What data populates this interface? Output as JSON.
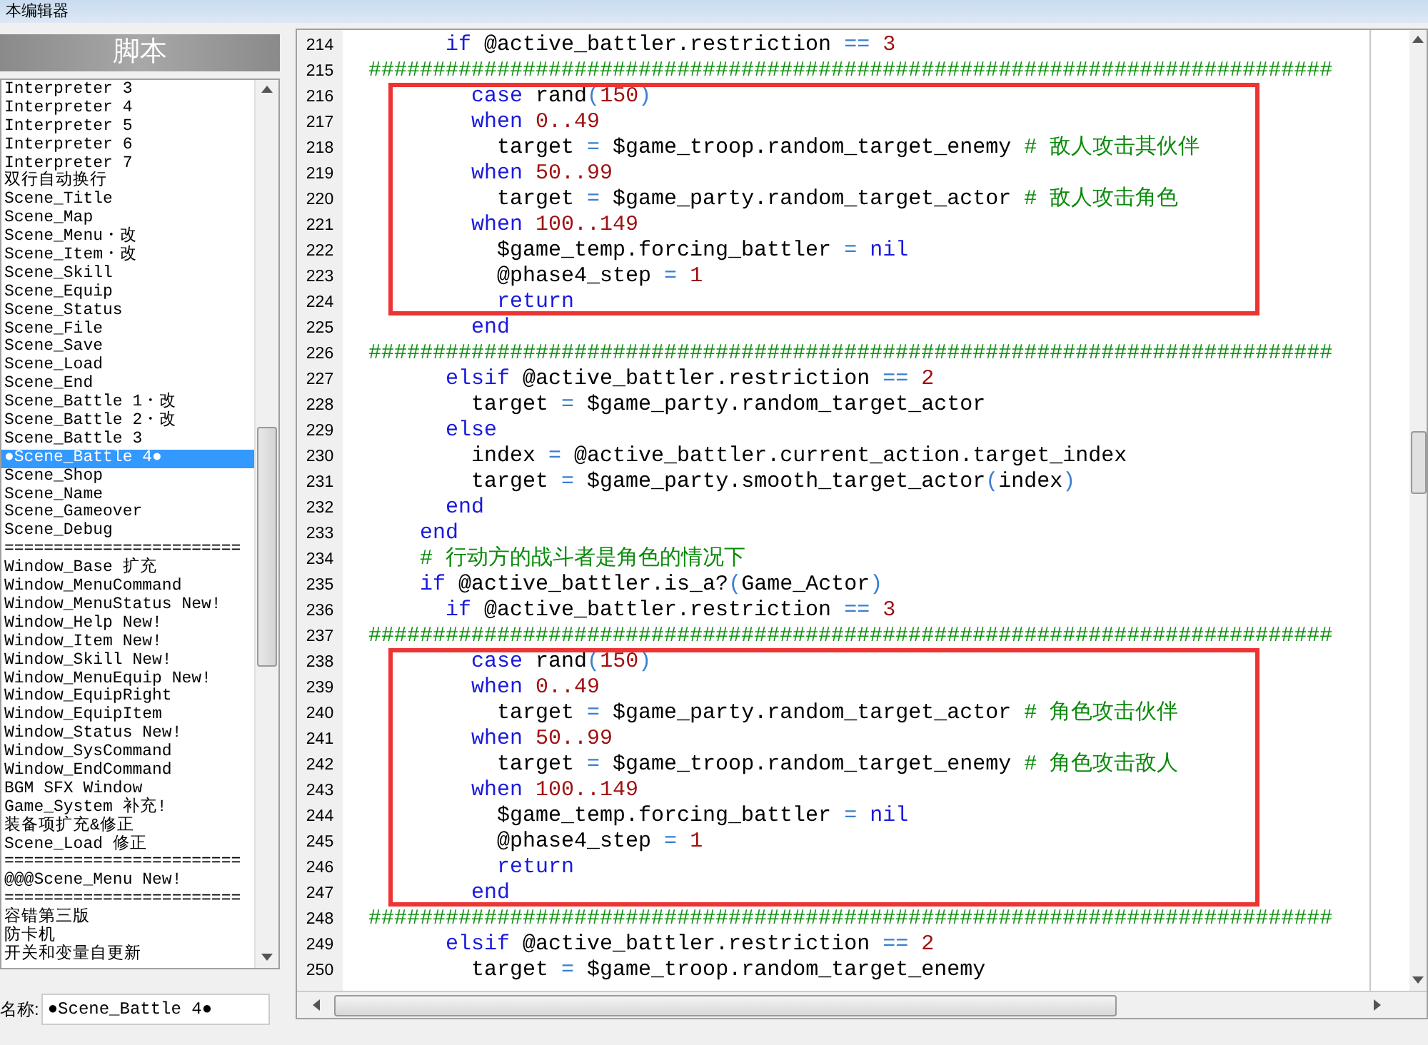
{
  "window": {
    "title": "本编辑器"
  },
  "sidebar": {
    "header": "脚本",
    "items": [
      {
        "label": "Interpreter 3",
        "selected": false
      },
      {
        "label": "Interpreter 4",
        "selected": false
      },
      {
        "label": "Interpreter 5",
        "selected": false
      },
      {
        "label": "Interpreter 6",
        "selected": false
      },
      {
        "label": "Interpreter 7",
        "selected": false
      },
      {
        "label": "双行自动换行",
        "selected": false
      },
      {
        "label": "Scene_Title",
        "selected": false
      },
      {
        "label": "Scene_Map",
        "selected": false
      },
      {
        "label": "Scene_Menu・改",
        "selected": false
      },
      {
        "label": "Scene_Item・改",
        "selected": false
      },
      {
        "label": "Scene_Skill",
        "selected": false
      },
      {
        "label": "Scene_Equip",
        "selected": false
      },
      {
        "label": "Scene_Status",
        "selected": false
      },
      {
        "label": "Scene_File",
        "selected": false
      },
      {
        "label": "Scene_Save",
        "selected": false
      },
      {
        "label": "Scene_Load",
        "selected": false
      },
      {
        "label": "Scene_End",
        "selected": false
      },
      {
        "label": "Scene_Battle 1・改",
        "selected": false
      },
      {
        "label": "Scene_Battle 2・改",
        "selected": false
      },
      {
        "label": "Scene_Battle 3",
        "selected": false
      },
      {
        "label": "●Scene_Battle 4●",
        "selected": true
      },
      {
        "label": "Scene_Shop",
        "selected": false
      },
      {
        "label": "Scene_Name",
        "selected": false
      },
      {
        "label": "Scene_Gameover",
        "selected": false
      },
      {
        "label": "Scene_Debug",
        "selected": false
      },
      {
        "label": "========================",
        "selected": false
      },
      {
        "label": "Window_Base 扩充",
        "selected": false
      },
      {
        "label": "Window_MenuCommand",
        "selected": false
      },
      {
        "label": "Window_MenuStatus New!",
        "selected": false
      },
      {
        "label": "Window_Help New!",
        "selected": false
      },
      {
        "label": "Window_Item New!",
        "selected": false
      },
      {
        "label": "Window_Skill New!",
        "selected": false
      },
      {
        "label": "Window_MenuEquip New!",
        "selected": false
      },
      {
        "label": "Window_EquipRight",
        "selected": false
      },
      {
        "label": "Window_EquipItem",
        "selected": false
      },
      {
        "label": "Window_Status New!",
        "selected": false
      },
      {
        "label": "Window_SysCommand",
        "selected": false
      },
      {
        "label": "Window_EndCommand",
        "selected": false
      },
      {
        "label": "BGM SFX Window",
        "selected": false
      },
      {
        "label": "Game_System 补充!",
        "selected": false
      },
      {
        "label": "装备项扩充&修正",
        "selected": false
      },
      {
        "label": "Scene_Load 修正",
        "selected": false
      },
      {
        "label": "========================",
        "selected": false
      },
      {
        "label": "@@@Scene_Menu New!",
        "selected": false
      },
      {
        "label": "========================",
        "selected": false
      },
      {
        "label": "容错第三版",
        "selected": false
      },
      {
        "label": "防卡机",
        "selected": false
      },
      {
        "label": "开关和变量自更新",
        "selected": false
      }
    ]
  },
  "name_field": {
    "label": "名称:",
    "value": "●Scene_Battle 4●"
  },
  "editor": {
    "lines": [
      {
        "number": "214",
        "boxed": false,
        "tokens": [
          {
            "kind": "kw",
            "text": "      if"
          },
          {
            "kind": "txt",
            "text": " @active_battler.restriction "
          },
          {
            "kind": "op",
            "text": "=="
          },
          {
            "kind": "num",
            "text": " 3"
          }
        ]
      },
      {
        "number": "215",
        "boxed": false,
        "tokens": [
          {
            "kind": "sep",
            "text": "###########################################################################"
          }
        ]
      },
      {
        "number": "216",
        "boxed": true,
        "tokens": [
          {
            "kind": "kw",
            "text": "        case"
          },
          {
            "kind": "txt",
            "text": " rand"
          },
          {
            "kind": "op",
            "text": "("
          },
          {
            "kind": "num",
            "text": "150"
          },
          {
            "kind": "op",
            "text": ")"
          }
        ]
      },
      {
        "number": "217",
        "boxed": true,
        "tokens": [
          {
            "kind": "kw",
            "text": "        when"
          },
          {
            "kind": "num",
            "text": " 0..49"
          }
        ]
      },
      {
        "number": "218",
        "boxed": true,
        "tokens": [
          {
            "kind": "txt",
            "text": "          target "
          },
          {
            "kind": "op",
            "text": "="
          },
          {
            "kind": "txt",
            "text": " $game_troop.random_target_enemy "
          },
          {
            "kind": "cmt",
            "text": "# 敌人攻击其伙伴"
          }
        ]
      },
      {
        "number": "219",
        "boxed": true,
        "tokens": [
          {
            "kind": "kw",
            "text": "        when"
          },
          {
            "kind": "num",
            "text": " 50..99"
          }
        ]
      },
      {
        "number": "220",
        "boxed": true,
        "tokens": [
          {
            "kind": "txt",
            "text": "          target "
          },
          {
            "kind": "op",
            "text": "="
          },
          {
            "kind": "txt",
            "text": " $game_party.random_target_actor "
          },
          {
            "kind": "cmt",
            "text": "# 敌人攻击角色"
          }
        ]
      },
      {
        "number": "221",
        "boxed": true,
        "tokens": [
          {
            "kind": "kw",
            "text": "        when"
          },
          {
            "kind": "num",
            "text": " 100..149"
          }
        ]
      },
      {
        "number": "222",
        "boxed": true,
        "tokens": [
          {
            "kind": "txt",
            "text": "          $game_temp.forcing_battler "
          },
          {
            "kind": "op",
            "text": "="
          },
          {
            "kind": "kw",
            "text": " nil"
          }
        ]
      },
      {
        "number": "223",
        "boxed": true,
        "tokens": [
          {
            "kind": "txt",
            "text": "          @phase4_step "
          },
          {
            "kind": "op",
            "text": "="
          },
          {
            "kind": "num",
            "text": " 1"
          }
        ]
      },
      {
        "number": "224",
        "boxed": true,
        "tokens": [
          {
            "kind": "kw",
            "text": "          return"
          }
        ]
      },
      {
        "number": "225",
        "boxed": false,
        "tokens": [
          {
            "kind": "kw",
            "text": "        end"
          }
        ]
      },
      {
        "number": "226",
        "boxed": false,
        "tokens": [
          {
            "kind": "sep",
            "text": "###########################################################################"
          }
        ]
      },
      {
        "number": "227",
        "boxed": false,
        "tokens": [
          {
            "kind": "kw",
            "text": "      elsif"
          },
          {
            "kind": "txt",
            "text": " @active_battler.restriction "
          },
          {
            "kind": "op",
            "text": "=="
          },
          {
            "kind": "num",
            "text": " 2"
          }
        ]
      },
      {
        "number": "228",
        "boxed": false,
        "tokens": [
          {
            "kind": "txt",
            "text": "        target "
          },
          {
            "kind": "op",
            "text": "="
          },
          {
            "kind": "txt",
            "text": " $game_party.random_target_actor"
          }
        ]
      },
      {
        "number": "229",
        "boxed": false,
        "tokens": [
          {
            "kind": "kw",
            "text": "      else"
          }
        ]
      },
      {
        "number": "230",
        "boxed": false,
        "tokens": [
          {
            "kind": "txt",
            "text": "        index "
          },
          {
            "kind": "op",
            "text": "="
          },
          {
            "kind": "txt",
            "text": " @active_battler.current_action.target_index"
          }
        ]
      },
      {
        "number": "231",
        "boxed": false,
        "tokens": [
          {
            "kind": "txt",
            "text": "        target "
          },
          {
            "kind": "op",
            "text": "="
          },
          {
            "kind": "txt",
            "text": " $game_party.smooth_target_actor"
          },
          {
            "kind": "op",
            "text": "("
          },
          {
            "kind": "txt",
            "text": "index"
          },
          {
            "kind": "op",
            "text": ")"
          }
        ]
      },
      {
        "number": "232",
        "boxed": false,
        "tokens": [
          {
            "kind": "kw",
            "text": "      end"
          }
        ]
      },
      {
        "number": "233",
        "boxed": false,
        "tokens": [
          {
            "kind": "kw",
            "text": "    end"
          }
        ]
      },
      {
        "number": "234",
        "boxed": false,
        "tokens": [
          {
            "kind": "cmt",
            "text": "    # 行动方的战斗者是角色的情况下"
          }
        ]
      },
      {
        "number": "235",
        "boxed": false,
        "tokens": [
          {
            "kind": "kw",
            "text": "    if"
          },
          {
            "kind": "txt",
            "text": " @active_battler.is_a?"
          },
          {
            "kind": "op",
            "text": "("
          },
          {
            "kind": "txt",
            "text": "Game_Actor"
          },
          {
            "kind": "op",
            "text": ")"
          }
        ]
      },
      {
        "number": "236",
        "boxed": false,
        "tokens": [
          {
            "kind": "kw",
            "text": "      if"
          },
          {
            "kind": "txt",
            "text": " @active_battler.restriction "
          },
          {
            "kind": "op",
            "text": "=="
          },
          {
            "kind": "num",
            "text": " 3"
          }
        ]
      },
      {
        "number": "237",
        "boxed": false,
        "tokens": [
          {
            "kind": "sep",
            "text": "###########################################################################"
          }
        ]
      },
      {
        "number": "238",
        "boxed": true,
        "tokens": [
          {
            "kind": "kw",
            "text": "        case"
          },
          {
            "kind": "txt",
            "text": " rand"
          },
          {
            "kind": "op",
            "text": "("
          },
          {
            "kind": "num",
            "text": "150"
          },
          {
            "kind": "op",
            "text": ")"
          }
        ]
      },
      {
        "number": "239",
        "boxed": true,
        "tokens": [
          {
            "kind": "kw",
            "text": "        when"
          },
          {
            "kind": "num",
            "text": " 0..49"
          }
        ]
      },
      {
        "number": "240",
        "boxed": true,
        "tokens": [
          {
            "kind": "txt",
            "text": "          target "
          },
          {
            "kind": "op",
            "text": "="
          },
          {
            "kind": "txt",
            "text": " $game_party.random_target_actor "
          },
          {
            "kind": "cmt",
            "text": "# 角色攻击伙伴"
          }
        ]
      },
      {
        "number": "241",
        "boxed": true,
        "tokens": [
          {
            "kind": "kw",
            "text": "        when"
          },
          {
            "kind": "num",
            "text": " 50..99"
          }
        ]
      },
      {
        "number": "242",
        "boxed": true,
        "tokens": [
          {
            "kind": "txt",
            "text": "          target "
          },
          {
            "kind": "op",
            "text": "="
          },
          {
            "kind": "txt",
            "text": " $game_troop.random_target_enemy "
          },
          {
            "kind": "cmt",
            "text": "# 角色攻击敌人"
          }
        ]
      },
      {
        "number": "243",
        "boxed": true,
        "tokens": [
          {
            "kind": "kw",
            "text": "        when"
          },
          {
            "kind": "num",
            "text": " 100..149"
          }
        ]
      },
      {
        "number": "244",
        "boxed": true,
        "tokens": [
          {
            "kind": "txt",
            "text": "          $game_temp.forcing_battler "
          },
          {
            "kind": "op",
            "text": "="
          },
          {
            "kind": "kw",
            "text": " nil"
          }
        ]
      },
      {
        "number": "245",
        "boxed": true,
        "tokens": [
          {
            "kind": "txt",
            "text": "          @phase4_step "
          },
          {
            "kind": "op",
            "text": "="
          },
          {
            "kind": "num",
            "text": " 1"
          }
        ]
      },
      {
        "number": "246",
        "boxed": true,
        "tokens": [
          {
            "kind": "kw",
            "text": "          return"
          }
        ]
      },
      {
        "number": "247",
        "boxed": true,
        "tokens": [
          {
            "kind": "kw",
            "text": "        end"
          }
        ]
      },
      {
        "number": "248",
        "boxed": false,
        "tokens": [
          {
            "kind": "sep",
            "text": "###########################################################################"
          }
        ]
      },
      {
        "number": "249",
        "boxed": false,
        "tokens": [
          {
            "kind": "kw",
            "text": "      elsif"
          },
          {
            "kind": "txt",
            "text": " @active_battler.restriction "
          },
          {
            "kind": "op",
            "text": "=="
          },
          {
            "kind": "num",
            "text": " 2"
          }
        ]
      },
      {
        "number": "250",
        "boxed": false,
        "tokens": [
          {
            "kind": "txt",
            "text": "        target "
          },
          {
            "kind": "op",
            "text": "="
          },
          {
            "kind": "txt",
            "text": " $game_troop.random_target_enemy"
          }
        ]
      }
    ]
  }
}
